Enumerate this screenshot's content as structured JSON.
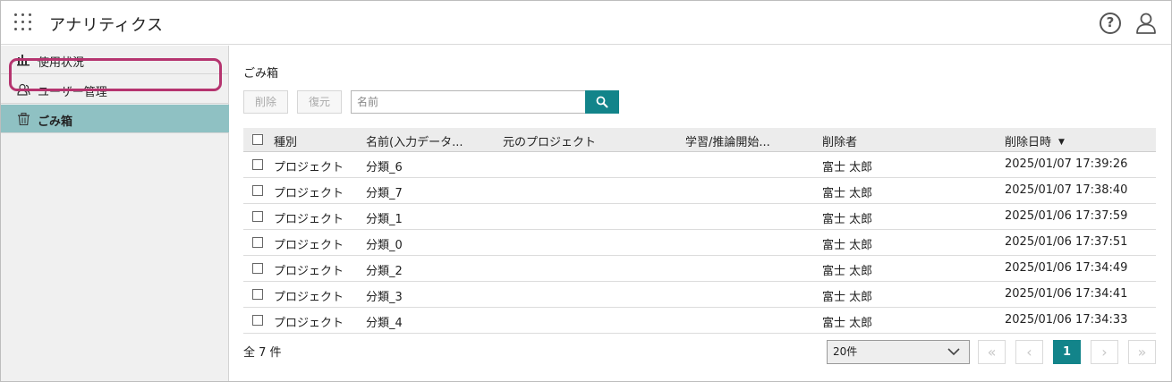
{
  "header": {
    "app_title": "アナリティクス",
    "apps_icon": "apps-grid-icon",
    "help_icon": "help-circle-icon",
    "help_glyph": "?",
    "user_icon": "user-icon"
  },
  "sidebar": {
    "items": [
      {
        "label": "使用状況",
        "icon": "bar-chart-icon"
      },
      {
        "label": "ユーザー管理",
        "icon": "users-icon"
      },
      {
        "label": "ごみ箱",
        "icon": "trash-icon",
        "active": true
      }
    ]
  },
  "main": {
    "title": "ごみ箱",
    "toolbar": {
      "delete_label": "削除",
      "restore_label": "復元",
      "search_placeholder": "名前",
      "search_icon": "search-icon"
    },
    "table": {
      "columns": [
        "種別",
        "名前(入力データ...",
        "元のプロジェクト",
        "学習/推論開始...",
        "削除者",
        "削除日時"
      ],
      "sort_indicator": "▼",
      "rows": [
        {
          "type": "プロジェクト",
          "name": "分類_6",
          "source": "",
          "started": "",
          "deleted_by": "富士 太郎",
          "deleted_at": "2025/01/07 17:39:26"
        },
        {
          "type": "プロジェクト",
          "name": "分類_7",
          "source": "",
          "started": "",
          "deleted_by": "富士 太郎",
          "deleted_at": "2025/01/07 17:38:40"
        },
        {
          "type": "プロジェクト",
          "name": "分類_1",
          "source": "",
          "started": "",
          "deleted_by": "富士 太郎",
          "deleted_at": "2025/01/06 17:37:59"
        },
        {
          "type": "プロジェクト",
          "name": "分類_0",
          "source": "",
          "started": "",
          "deleted_by": "富士 太郎",
          "deleted_at": "2025/01/06 17:37:51"
        },
        {
          "type": "プロジェクト",
          "name": "分類_2",
          "source": "",
          "started": "",
          "deleted_by": "富士 太郎",
          "deleted_at": "2025/01/06 17:34:49"
        },
        {
          "type": "プロジェクト",
          "name": "分類_3",
          "source": "",
          "started": "",
          "deleted_by": "富士 太郎",
          "deleted_at": "2025/01/06 17:34:41"
        },
        {
          "type": "プロジェクト",
          "name": "分類_4",
          "source": "",
          "started": "",
          "deleted_by": "富士 太郎",
          "deleted_at": "2025/01/06 17:34:33"
        }
      ]
    },
    "footer": {
      "total_label": "全 7 件",
      "page_size": "20件",
      "pagination": {
        "first": "«",
        "prev": "‹",
        "current": "1",
        "next": "›",
        "last": "»"
      }
    }
  },
  "colors": {
    "accent": "#12848a",
    "sidebar_active": "#8fc1c3",
    "highlight": "#b5346f"
  }
}
